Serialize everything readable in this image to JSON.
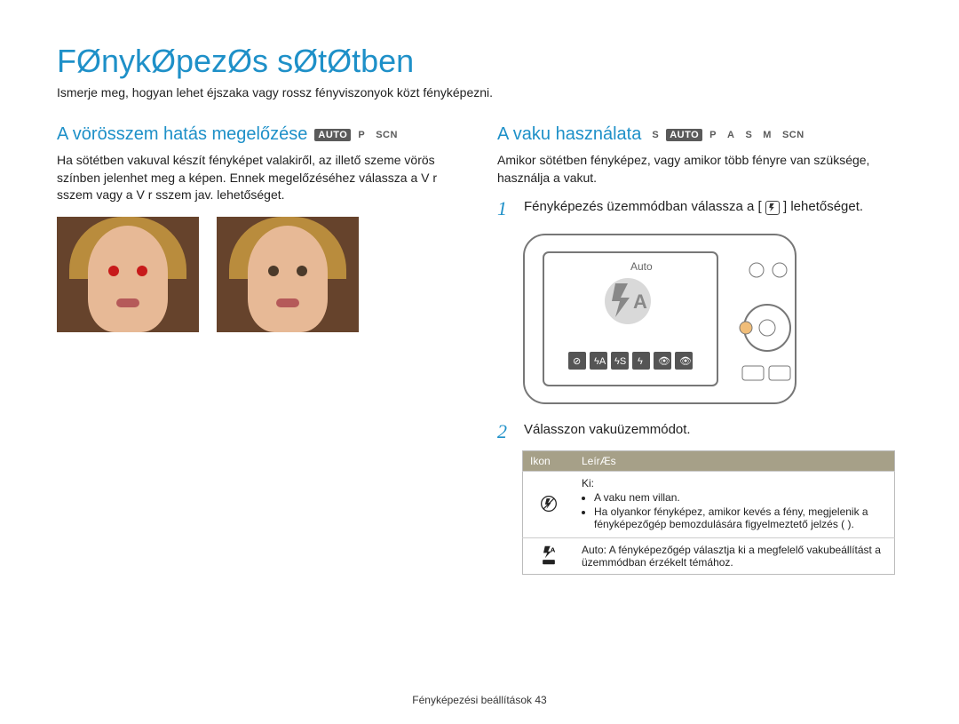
{
  "page": {
    "title": "FØnykØpezØs sØtØtben",
    "intro": "Ismerje meg, hogyan lehet éjszaka vagy rossz fényviszonyok közt fényképezni.",
    "footer": "Fényképezési beállítások  43"
  },
  "left": {
    "heading": "A vörösszem hatás megelőzése",
    "modes": [
      "AUTO",
      "P",
      "SCN"
    ],
    "body": "Ha sötétben vakuval készít fényképet valakiről, az illető szeme vörös színben jelenhet meg a képen. Ennek megelőzéséhez válassza a V r sszem  vagy a V r sszem jav. lehetőséget."
  },
  "right": {
    "heading": "A vaku használata",
    "modes": [
      "S",
      "AUTO",
      "P",
      "A",
      "S",
      "M",
      "SCN"
    ],
    "body": "Amikor sötétben fényképez, vagy amikor több fényre van szüksége, használja a vakut.",
    "step1_a": "Fényképezés üzemmódban válassza a [",
    "step1_b": "] lehetőséget.",
    "camera_label": "Auto",
    "step2": "Válasszon vakuüzemmódot.",
    "table": {
      "head_icon": "Ikon",
      "head_desc": "LeírÆs",
      "rows": [
        {
          "title": "Ki:",
          "bullets": [
            "A vaku nem villan.",
            "Ha olyankor fényképez, amikor kevés a fény, megjelenik a fényképezőgép bemozdulására figyelmeztető jelzés (  )."
          ],
          "icon": "flash-off"
        },
        {
          "title": "Auto: A fényképezőgép választja ki a megfelelő vakubeállítást a  üzemmódban érzékelt témához.",
          "bullets": [],
          "icon": "flash-auto-smart"
        }
      ]
    }
  }
}
